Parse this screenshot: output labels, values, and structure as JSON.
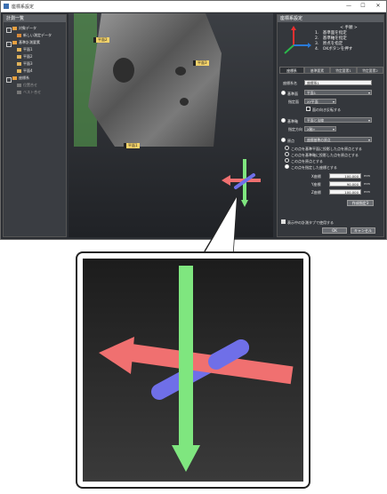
{
  "window": {
    "title": "座標系設定",
    "controls": [
      "—",
      "☐",
      "✕"
    ]
  },
  "tree": {
    "header": "計測一覧",
    "items": [
      {
        "label": "対象データ",
        "level": 0,
        "checked": true
      },
      {
        "label": "新しい測定データ",
        "level": 1,
        "checked": true
      },
      {
        "label": "基準計測要素",
        "level": 0,
        "checked": true
      },
      {
        "label": "平面1",
        "level": 1,
        "checked": true
      },
      {
        "label": "平面2",
        "level": 1,
        "checked": true
      },
      {
        "label": "平面3",
        "level": 1,
        "checked": true
      },
      {
        "label": "平面4",
        "level": 1,
        "checked": true
      },
      {
        "label": "座標系",
        "level": 0,
        "checked": true
      },
      {
        "label": "位置合せ",
        "level": 1,
        "checked": false
      },
      {
        "label": "ベスト合せ",
        "level": 1,
        "checked": false
      }
    ]
  },
  "viewport": {
    "labels": [
      "平面2",
      "平面3",
      "平面1"
    ]
  },
  "panel": {
    "header": "座標系設定",
    "steps_title": "< 手順 >",
    "steps": [
      "1.　基準面を指定",
      "2.　基準軸を指定",
      "3.　原点を指定",
      "4.　OKボタンを押す"
    ],
    "tabs": [
      "座標系",
      "基準要素",
      "特定要素1",
      "特定要素2"
    ],
    "name_label": "座標系名",
    "name_value": "座標系1",
    "base_plane_label": "基準面",
    "base_plane_value": "平面1",
    "specify_label": "指定面",
    "specify_value": "XY平面",
    "reverse_label": "面の向き反転する",
    "base_axis_label": "基準軸",
    "base_axis_value": "平面と法線",
    "axis_dir_label": "指定方向",
    "axis_dir_value": "X軸+",
    "origin_label": "原点",
    "origin_value": "座標基準の原点",
    "origin_options": [
      "この点を基準平面に投影した点を原点とする",
      "この点を基準軸に投影した点を原点とする",
      "この点を原点とする",
      "この点を指定した座標とする"
    ],
    "coords": [
      {
        "label": "X座標",
        "value": "100.000",
        "unit": "mm"
      },
      {
        "label": "Y座標",
        "value": "90.000",
        "unit": "mm"
      },
      {
        "label": "Z座標",
        "value": "100.000",
        "unit": "mm"
      }
    ],
    "create_button": "作成指定3",
    "auto_check_label": "表示中の計測タブで使用する",
    "ok_label": "OK",
    "cancel_label": "キャンセル"
  },
  "colors": {
    "axis_x": "#f07070",
    "axis_y": "#7fe67f",
    "axis_z": "#6f6fe8"
  }
}
